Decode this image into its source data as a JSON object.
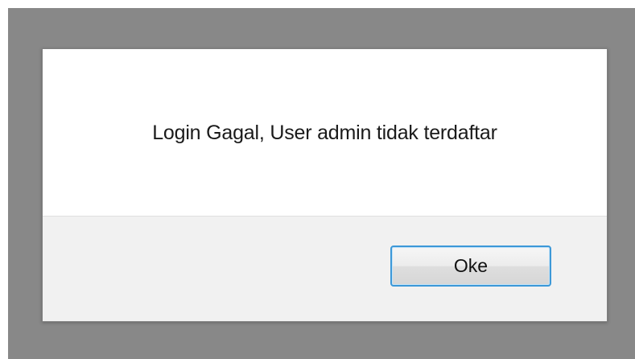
{
  "dialog": {
    "message": "Login Gagal, User admin tidak terdaftar",
    "ok_label": "Oke"
  },
  "colors": {
    "backdrop": "#888888",
    "dialog_body": "#ffffff",
    "dialog_footer": "#f1f1f1",
    "button_focus_border": "#3c98d8"
  }
}
